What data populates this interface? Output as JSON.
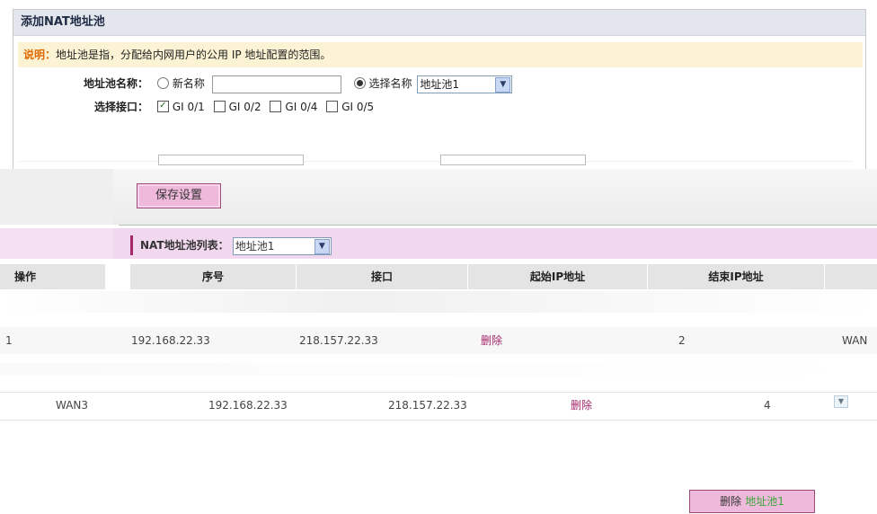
{
  "panel": {
    "title": "添加NAT地址池",
    "note_label": "说明：",
    "note_text": "地址池是指，分配给内网用户的公用 IP 地址配置的范围。",
    "name_label": "地址池名称：",
    "new_name_option": "新名称",
    "select_name_option": "选择名称",
    "selected_pool": "地址池1",
    "iface_label": "选择接口：",
    "interfaces": [
      {
        "label": "GI 0/1",
        "checked": true
      },
      {
        "label": "GI 0/2",
        "checked": false
      },
      {
        "label": "GI 0/4",
        "checked": false
      },
      {
        "label": "GI 0/5",
        "checked": false
      }
    ]
  },
  "actions": {
    "save_label": "保存设置"
  },
  "pool_list": {
    "label": "NAT地址池列表：",
    "selected": "地址池1"
  },
  "table": {
    "headers": [
      "操作",
      "序号",
      "接口",
      "起始IP地址",
      "结束IP地址"
    ],
    "rows": [
      {
        "first": "1",
        "start_ip": "192.168.22.33",
        "end_ip": "218.157.22.33",
        "op": "删除",
        "idx": "2",
        "iface": "WAN"
      },
      {
        "first": "WAN3",
        "start_ip": "192.168.22.33",
        "end_ip": "218.157.22.33",
        "op": "删除",
        "idx": "4",
        "iface": ""
      }
    ]
  },
  "footer": {
    "delete_label": "删除",
    "delete_pool": "地址池1"
  }
}
